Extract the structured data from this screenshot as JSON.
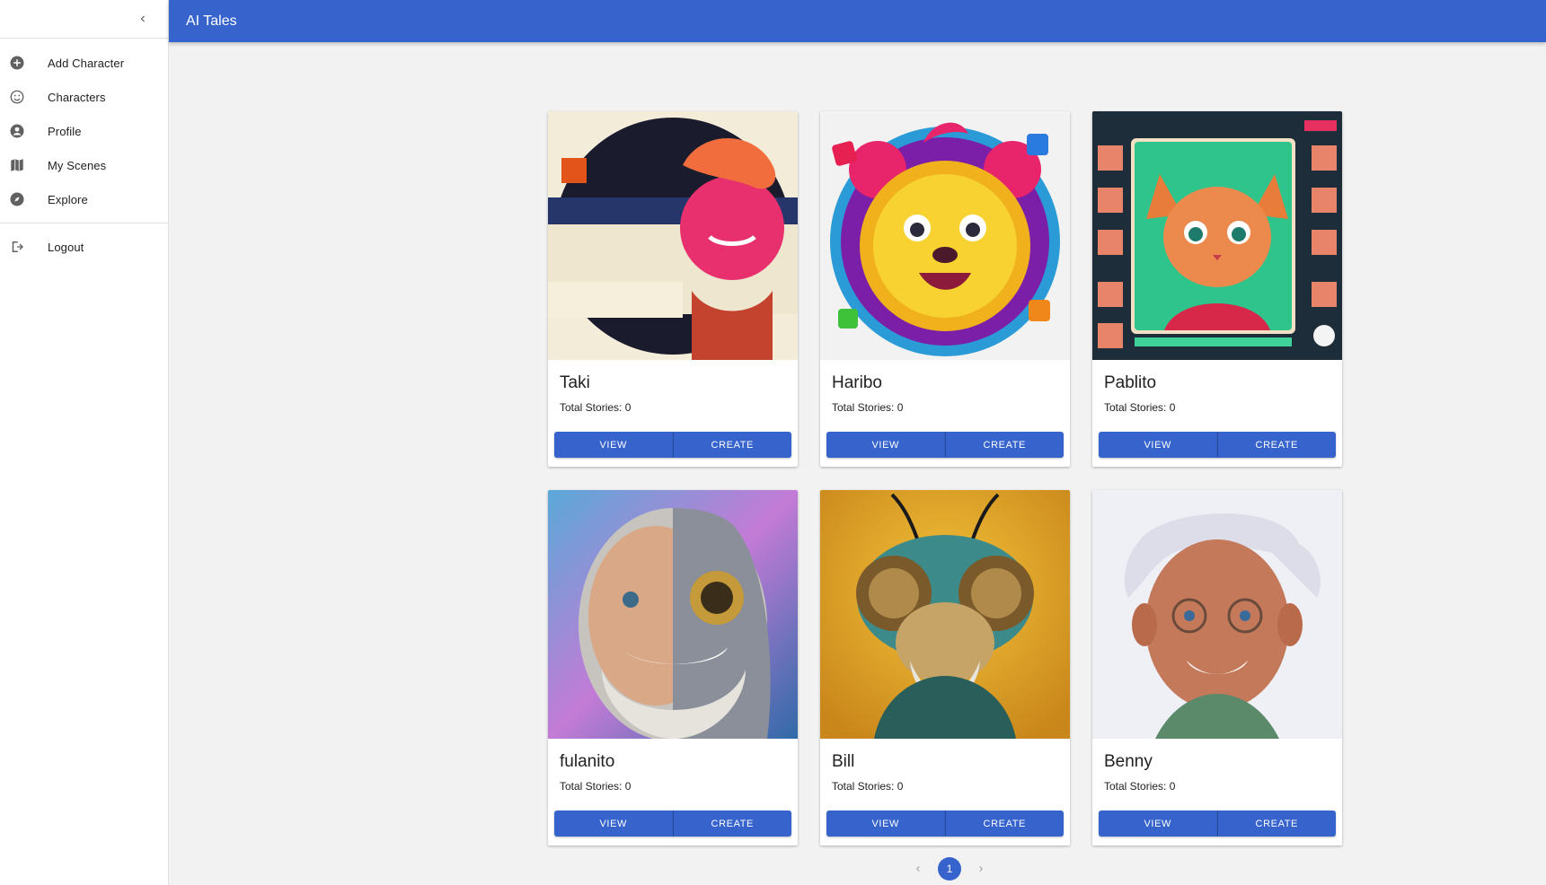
{
  "app": {
    "title": "AI Tales"
  },
  "sidebar": {
    "collapse_icon": "chevron-left-icon",
    "items": [
      {
        "label": "Add Character",
        "icon": "add-circle-icon"
      },
      {
        "label": "Characters",
        "icon": "smiley-icon"
      },
      {
        "label": "Profile",
        "icon": "account-circle-icon"
      },
      {
        "label": "My Scenes",
        "icon": "book-map-icon"
      },
      {
        "label": "Explore",
        "icon": "compass-icon"
      }
    ],
    "logout": {
      "label": "Logout",
      "icon": "logout-icon"
    }
  },
  "characters": [
    {
      "name": "Taki",
      "stats": "Total Stories: 0",
      "view_label": "VIEW",
      "create_label": "CREATE"
    },
    {
      "name": "Haribo",
      "stats": "Total Stories: 0",
      "view_label": "VIEW",
      "create_label": "CREATE"
    },
    {
      "name": "Pablito",
      "stats": "Total Stories: 0",
      "view_label": "VIEW",
      "create_label": "CREATE"
    },
    {
      "name": "fulanito",
      "stats": "Total Stories: 0",
      "view_label": "VIEW",
      "create_label": "CREATE"
    },
    {
      "name": "Bill",
      "stats": "Total Stories: 0",
      "view_label": "VIEW",
      "create_label": "CREATE"
    },
    {
      "name": "Benny",
      "stats": "Total Stories: 0",
      "view_label": "VIEW",
      "create_label": "CREATE"
    }
  ],
  "pagination": {
    "current_page": "1"
  },
  "colors": {
    "primary": "#3663cc",
    "background": "#f2f2f2"
  }
}
